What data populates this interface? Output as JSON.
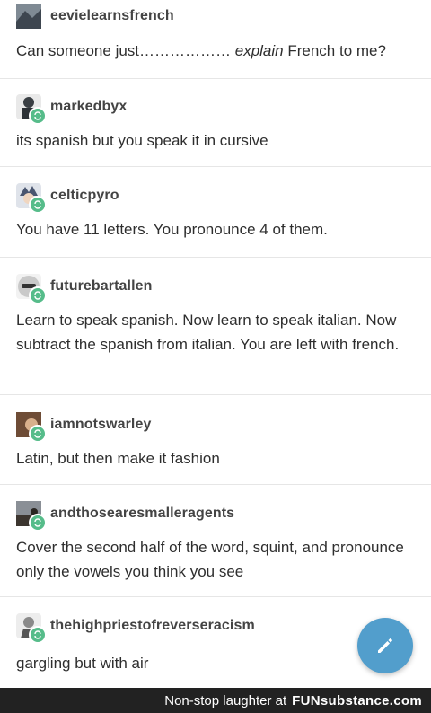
{
  "posts": [
    {
      "username": "eevielearnsfrench",
      "text_before": "Can someone just……………… ",
      "text_em": "explain",
      "text_after": " French to me?",
      "avatar_color": "#6f7a84"
    },
    {
      "username": "markedbyx",
      "text": "its spanish but you speak it in cursive",
      "avatar_color": "#3a3f44"
    },
    {
      "username": "celticpyro",
      "text": "You have 11 letters. You pronounce 4 of them.",
      "avatar_color": "#4a5670"
    },
    {
      "username": "futurebartallen",
      "text": "Learn to speak spanish. Now learn to speak italian. Now subtract the spanish from italian. You are left with french.",
      "avatar_color": "#8a8f93"
    },
    {
      "username": "iamnotswarley",
      "text": "Latin, but then make it fashion",
      "avatar_color": "#7a5a44"
    },
    {
      "username": "andthosearesmalleragents",
      "text": "Cover the second half of the word, squint, and pronounce only the vowels you think you see",
      "avatar_color": "#5a5048"
    },
    {
      "username": "thehighpriestofreverseracism",
      "text": "gargling but with air",
      "avatar_color": "#6b6b6b"
    }
  ],
  "fab": {
    "icon": "pencil-icon",
    "color": "#529ecc"
  },
  "footer": {
    "text": "Non-stop laughter at",
    "brand": "FUNsubstance.com"
  },
  "colors": {
    "reblog_badge": "#56bc8a"
  }
}
